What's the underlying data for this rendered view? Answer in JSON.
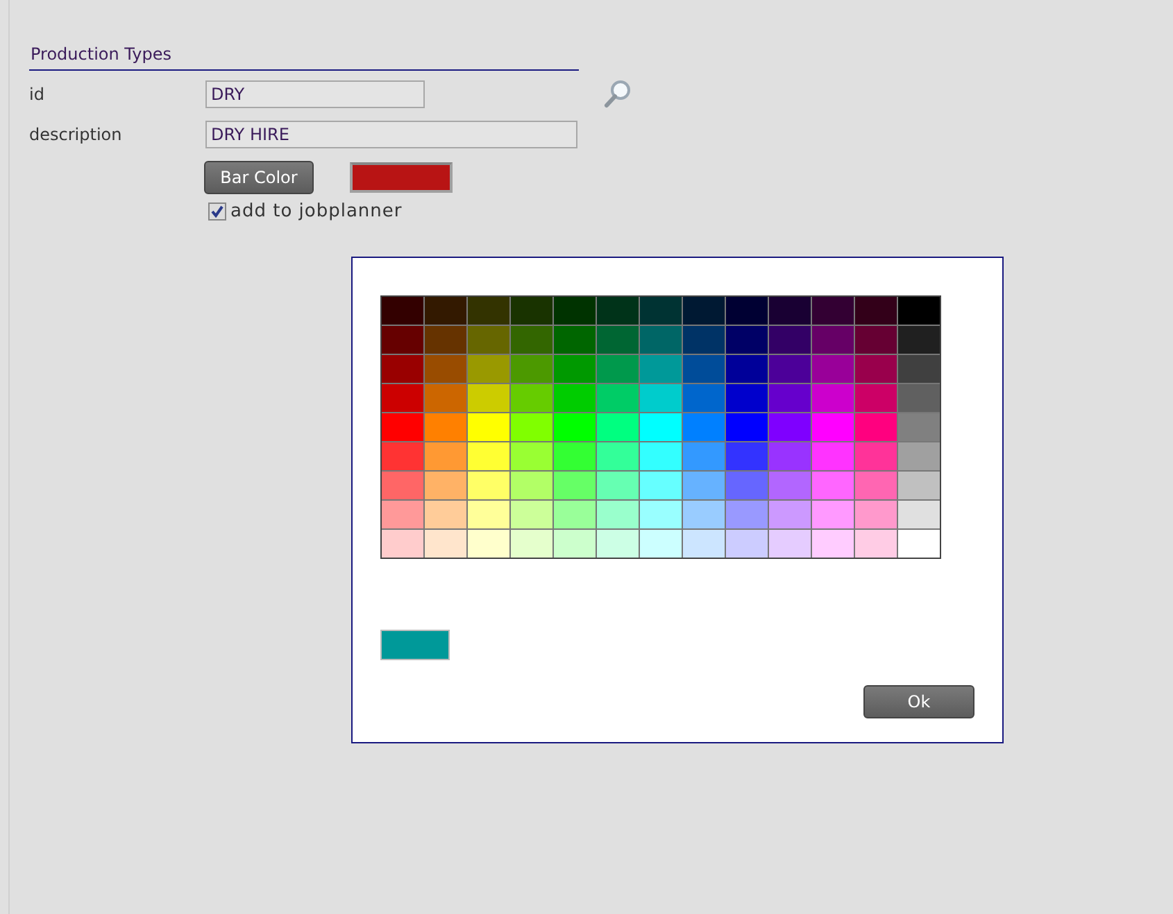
{
  "section": {
    "title": "Production Types"
  },
  "fields": [
    {
      "label": "id",
      "value": "DRY",
      "kind": "short"
    },
    {
      "label": "description",
      "value": "DRY HIRE",
      "kind": "long"
    }
  ],
  "bar_color": {
    "button": "Bar Color",
    "color": "#b81414"
  },
  "add_to_jobplanner": {
    "label": "add to jobplanner",
    "checked": true
  },
  "color_dialog": {
    "palette": [
      [
        {
          "color": "#330000"
        },
        {
          "color": "#331900"
        },
        {
          "color": "#333300"
        },
        {
          "color": "#193300"
        },
        {
          "color": "#003300"
        },
        {
          "color": "#003319"
        },
        {
          "color": "#003333"
        },
        {
          "color": "#001933"
        },
        {
          "color": "#000033"
        },
        {
          "color": "#190033"
        },
        {
          "color": "#330033"
        },
        {
          "color": "#330019"
        },
        {
          "color": "#000000"
        }
      ],
      [
        {
          "color": "#660000"
        },
        {
          "color": "#663300"
        },
        {
          "color": "#666600"
        },
        {
          "color": "#336600"
        },
        {
          "color": "#006600"
        },
        {
          "color": "#006633"
        },
        {
          "color": "#006666"
        },
        {
          "color": "#003366"
        },
        {
          "color": "#000066"
        },
        {
          "color": "#330066"
        },
        {
          "color": "#660066"
        },
        {
          "color": "#660033"
        },
        {
          "color": "#202020"
        }
      ],
      [
        {
          "color": "#990000"
        },
        {
          "color": "#994c00"
        },
        {
          "color": "#999900"
        },
        {
          "color": "#4c9900"
        },
        {
          "color": "#009900"
        },
        {
          "color": "#00994c"
        },
        {
          "color": "#009999"
        },
        {
          "color": "#004c99"
        },
        {
          "color": "#000099"
        },
        {
          "color": "#4c0099"
        },
        {
          "color": "#990099"
        },
        {
          "color": "#99004c"
        },
        {
          "color": "#404040"
        }
      ],
      [
        {
          "color": "#cc0000"
        },
        {
          "color": "#cc6600"
        },
        {
          "color": "#cccc00"
        },
        {
          "color": "#66cc00"
        },
        {
          "color": "#00cc00"
        },
        {
          "color": "#00cc66"
        },
        {
          "color": "#00cccc"
        },
        {
          "color": "#0066cc"
        },
        {
          "color": "#0000cc"
        },
        {
          "color": "#6600cc"
        },
        {
          "color": "#cc00cc"
        },
        {
          "color": "#cc0066"
        },
        {
          "color": "#606060"
        }
      ],
      [
        {
          "color": "#ff0000"
        },
        {
          "color": "#ff8000"
        },
        {
          "color": "#ffff00"
        },
        {
          "color": "#80ff00"
        },
        {
          "color": "#00ff00"
        },
        {
          "color": "#00ff80"
        },
        {
          "color": "#00ffff"
        },
        {
          "color": "#0080ff"
        },
        {
          "color": "#0000ff"
        },
        {
          "color": "#7f00ff"
        },
        {
          "color": "#ff00ff"
        },
        {
          "color": "#ff007f"
        },
        {
          "color": "#808080"
        }
      ],
      [
        {
          "color": "#ff3333"
        },
        {
          "color": "#ff9933"
        },
        {
          "color": "#ffff33"
        },
        {
          "color": "#99ff33"
        },
        {
          "color": "#33ff33"
        },
        {
          "color": "#33ff99"
        },
        {
          "color": "#33ffff"
        },
        {
          "color": "#3399ff"
        },
        {
          "color": "#3333ff"
        },
        {
          "color": "#9933ff"
        },
        {
          "color": "#ff33ff"
        },
        {
          "color": "#ff3399"
        },
        {
          "color": "#a0a0a0"
        }
      ],
      [
        {
          "color": "#ff6666"
        },
        {
          "color": "#ffb266"
        },
        {
          "color": "#ffff66"
        },
        {
          "color": "#b2ff66"
        },
        {
          "color": "#66ff66"
        },
        {
          "color": "#66ffb2"
        },
        {
          "color": "#66ffff"
        },
        {
          "color": "#66b2ff"
        },
        {
          "color": "#6666ff"
        },
        {
          "color": "#b266ff"
        },
        {
          "color": "#ff66ff"
        },
        {
          "color": "#ff66b2"
        },
        {
          "color": "#c0c0c0"
        }
      ],
      [
        {
          "color": "#ff9999"
        },
        {
          "color": "#ffcc99"
        },
        {
          "color": "#ffff99"
        },
        {
          "color": "#ccff99"
        },
        {
          "color": "#99ff99"
        },
        {
          "color": "#99ffcc"
        },
        {
          "color": "#99ffff"
        },
        {
          "color": "#99ccff"
        },
        {
          "color": "#9999ff"
        },
        {
          "color": "#cc99ff"
        },
        {
          "color": "#ff99ff"
        },
        {
          "color": "#ff99cc"
        },
        {
          "color": "#e0e0e0"
        }
      ],
      [
        {
          "color": "#ffcccc"
        },
        {
          "color": "#ffe5cc"
        },
        {
          "color": "#ffffcc"
        },
        {
          "color": "#e5ffcc"
        },
        {
          "color": "#ccffcc"
        },
        {
          "color": "#ccffe5"
        },
        {
          "color": "#ccffff"
        },
        {
          "color": "#cce5ff"
        },
        {
          "color": "#ccccff"
        },
        {
          "color": "#e5ccff"
        },
        {
          "color": "#ffccff"
        },
        {
          "color": "#ffcce5"
        },
        {
          "color": "#ffffff"
        }
      ]
    ],
    "preview": {
      "color": "#009999"
    },
    "ok_button": "Ok"
  }
}
